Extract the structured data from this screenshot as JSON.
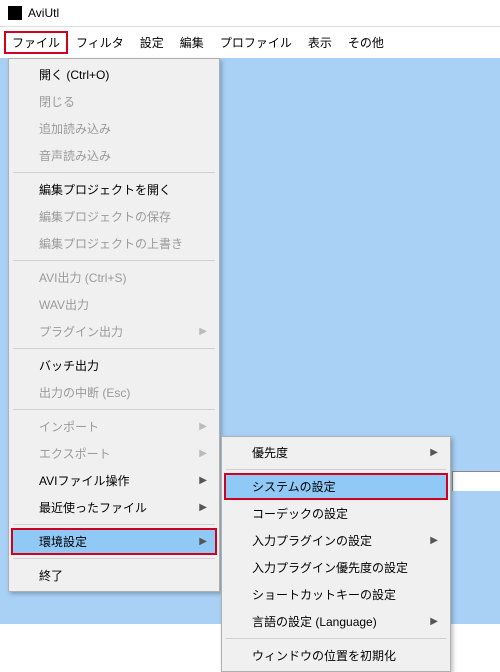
{
  "window": {
    "title": "AviUtl"
  },
  "menubar": {
    "items": [
      {
        "label": "ファイル",
        "open": true
      },
      {
        "label": "フィルタ"
      },
      {
        "label": "設定"
      },
      {
        "label": "編集"
      },
      {
        "label": "プロファイル"
      },
      {
        "label": "表示"
      },
      {
        "label": "その他"
      }
    ]
  },
  "file_menu": {
    "groups": [
      [
        {
          "label": "開く (Ctrl+O)"
        },
        {
          "label": "閉じる",
          "disabled": true
        },
        {
          "label": "追加読み込み",
          "disabled": true
        },
        {
          "label": "音声読み込み",
          "disabled": true
        }
      ],
      [
        {
          "label": "編集プロジェクトを開く"
        },
        {
          "label": "編集プロジェクトの保存",
          "disabled": true
        },
        {
          "label": "編集プロジェクトの上書き",
          "disabled": true
        }
      ],
      [
        {
          "label": "AVI出力 (Ctrl+S)",
          "disabled": true
        },
        {
          "label": "WAV出力",
          "disabled": true
        },
        {
          "label": "プラグイン出力",
          "submenu": true,
          "disabled": true
        }
      ],
      [
        {
          "label": "バッチ出力"
        },
        {
          "label": "出力の中断 (Esc)",
          "disabled": true
        }
      ],
      [
        {
          "label": "インポート",
          "submenu": true,
          "disabled": true
        },
        {
          "label": "エクスポート",
          "submenu": true,
          "disabled": true
        },
        {
          "label": "AVIファイル操作",
          "submenu": true
        },
        {
          "label": "最近使ったファイル",
          "submenu": true
        }
      ],
      [
        {
          "label": "環境設定",
          "submenu": true,
          "hovered": true,
          "redbox": true
        }
      ],
      [
        {
          "label": "終了"
        }
      ]
    ]
  },
  "env_submenu": {
    "groups": [
      [
        {
          "label": "優先度",
          "submenu": true
        }
      ],
      [
        {
          "label": "システムの設定",
          "hovered": true,
          "redbox": true
        },
        {
          "label": "コーデックの設定"
        },
        {
          "label": "入力プラグインの設定",
          "submenu": true
        },
        {
          "label": "入力プラグイン優先度の設定"
        },
        {
          "label": "ショートカットキーの設定"
        },
        {
          "label": "言語の設定 (Language)",
          "submenu": true
        }
      ],
      [
        {
          "label": "ウィンドウの位置を初期化"
        }
      ]
    ]
  }
}
